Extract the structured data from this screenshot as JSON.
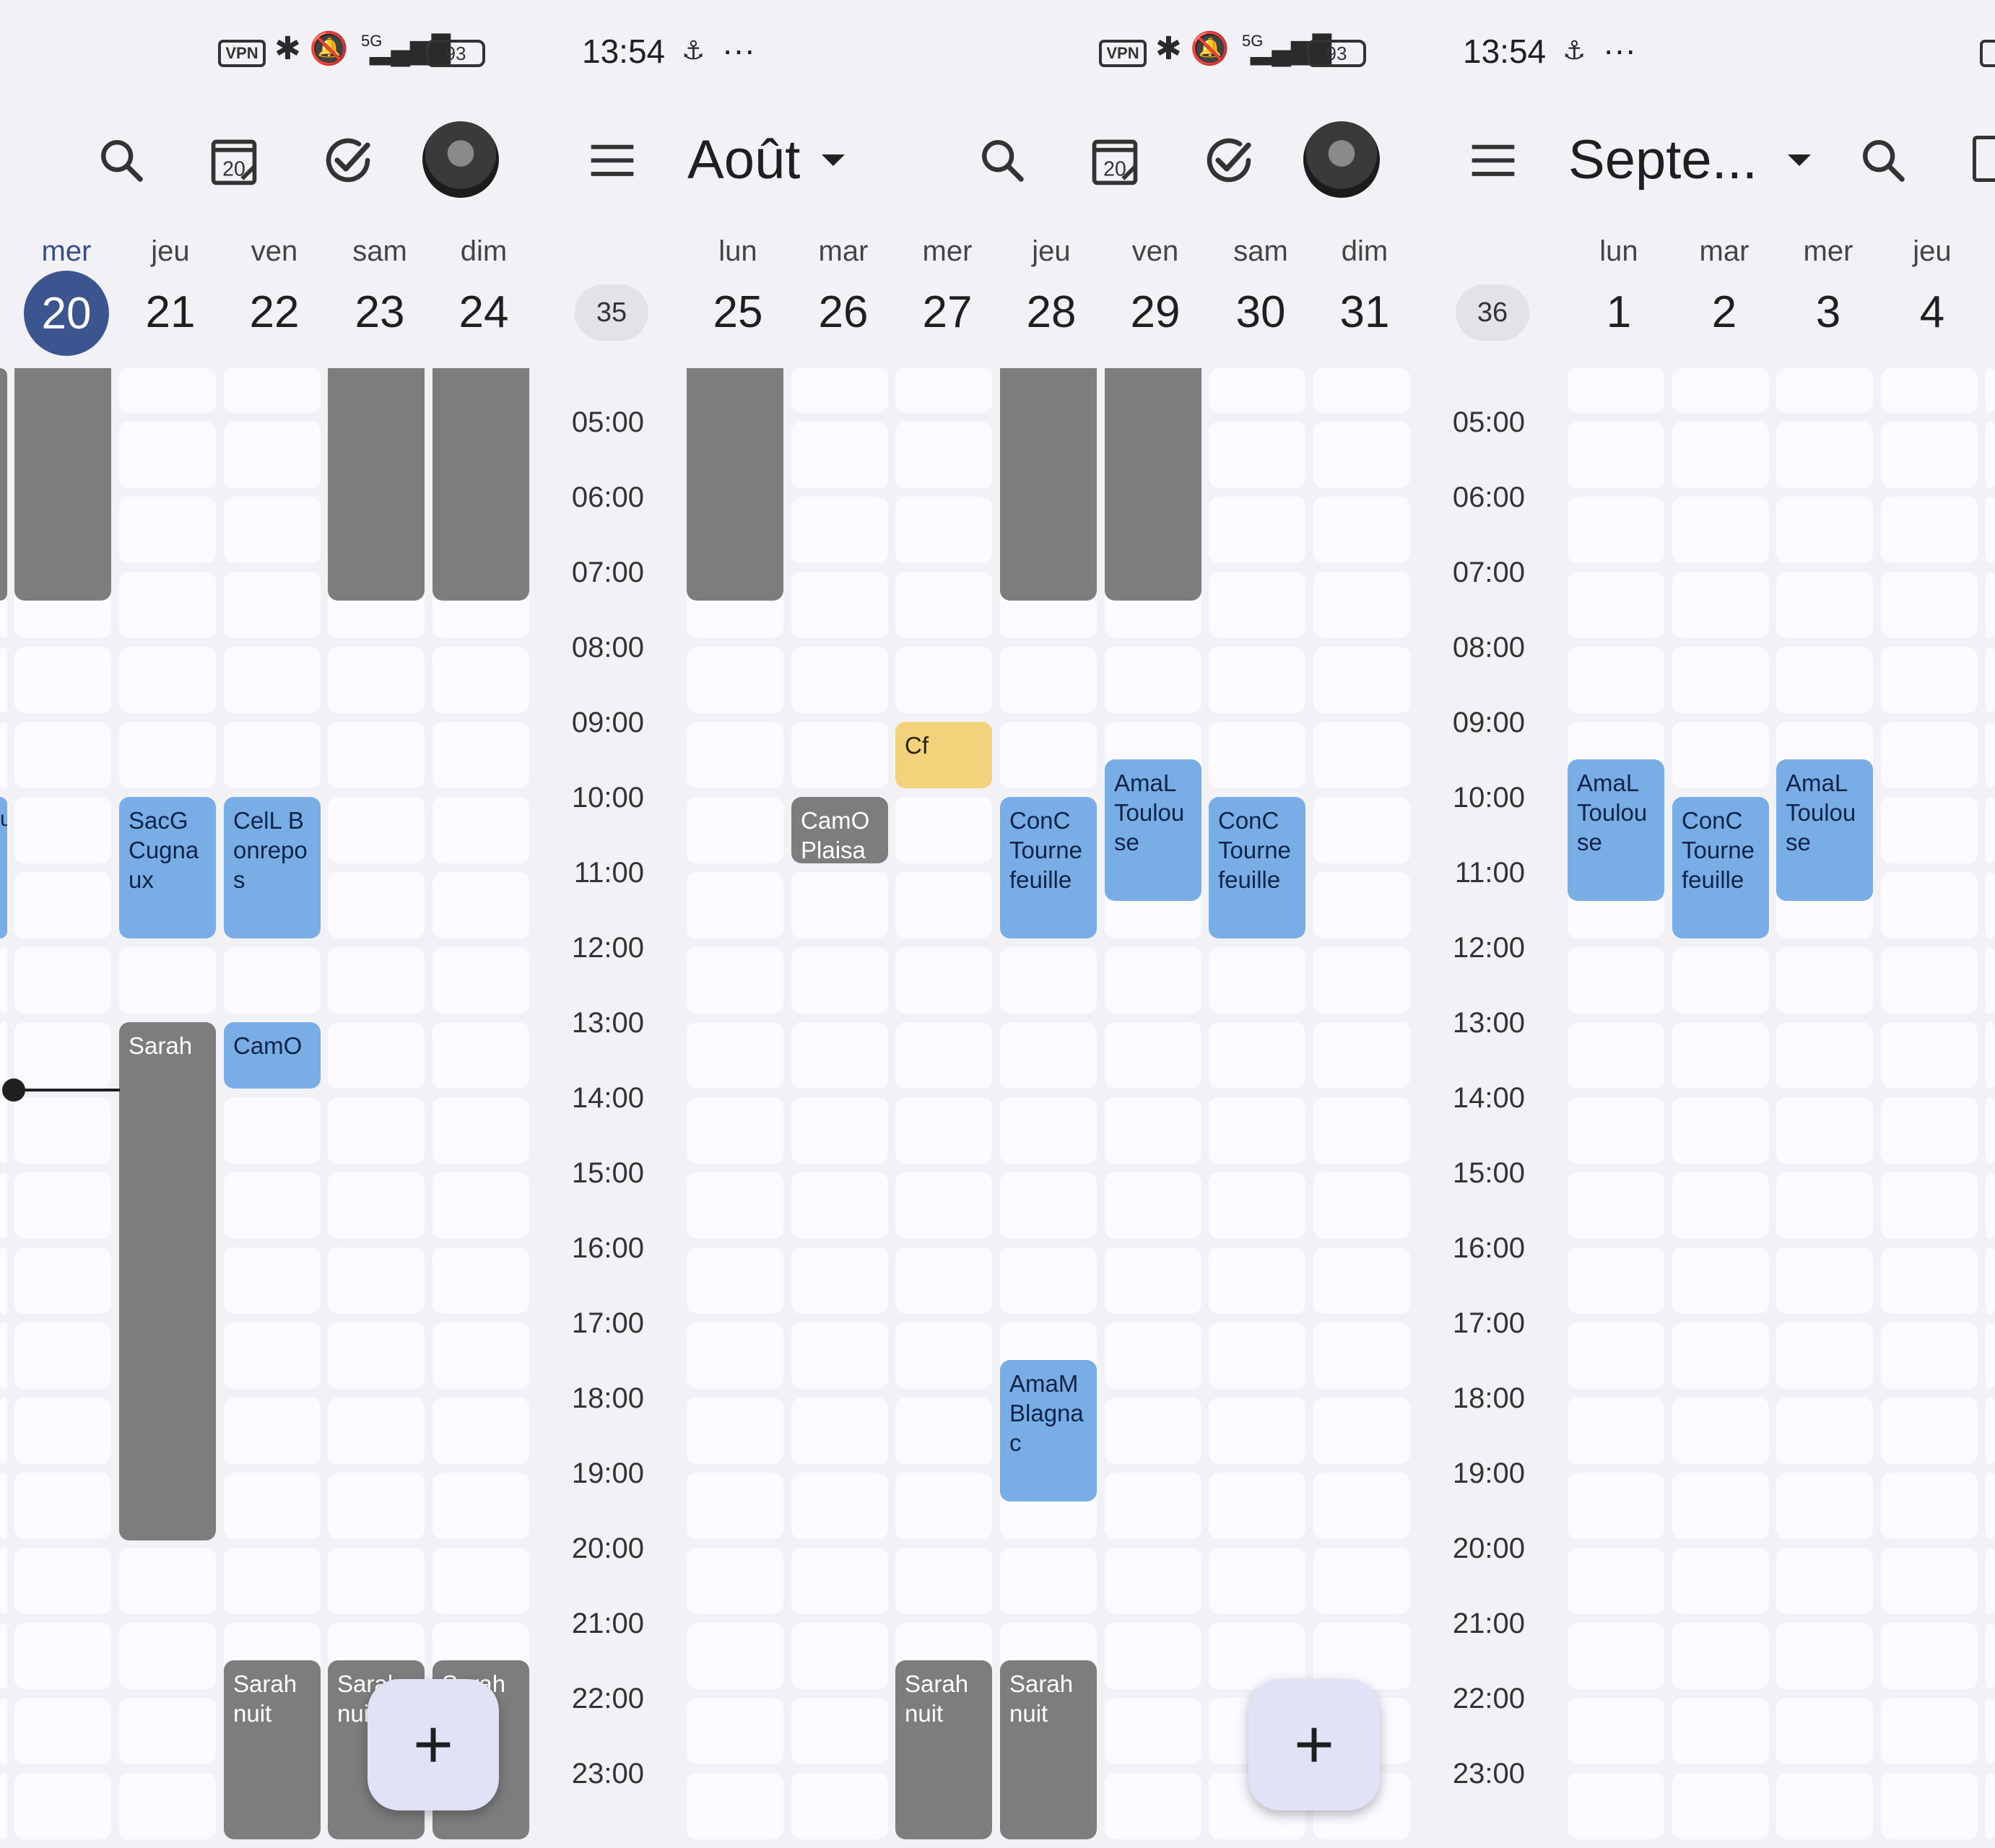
{
  "status_bar": {
    "time": "13:54",
    "vpn": "VPN",
    "network": "5G",
    "battery": "93",
    "more": "···",
    "icons": [
      "bluetooth-icon",
      "mute-icon",
      "signal-icon",
      "battery-icon",
      "sync-icon"
    ]
  },
  "toolbar": {
    "month_prev": "Août",
    "month_next": "Septe...",
    "today_num": "20",
    "icons": [
      "menu-icon",
      "search-icon",
      "today-icon",
      "tasks-icon",
      "avatar",
      "dropdown-icon"
    ]
  },
  "days": {
    "labels": [
      "mer",
      "jeu",
      "ven",
      "sam",
      "dim",
      "lun",
      "mar",
      "mer",
      "jeu",
      "ven",
      "sam",
      "dim",
      "lun",
      "mar",
      "mer",
      "jeu"
    ],
    "numbers": [
      "20",
      "21",
      "22",
      "23",
      "24",
      "25",
      "26",
      "27",
      "28",
      "29",
      "30",
      "31",
      "1",
      "2",
      "3",
      "4"
    ],
    "week_badges": [
      "35",
      "36"
    ]
  },
  "hours": [
    "05:00",
    "06:00",
    "07:00",
    "08:00",
    "09:00",
    "10:00",
    "11:00",
    "12:00",
    "13:00",
    "14:00",
    "15:00",
    "16:00",
    "17:00",
    "18:00",
    "19:00",
    "20:00",
    "21:00",
    "22:00",
    "23:00"
  ],
  "events": {
    "sacg": "SacG Cugnaux",
    "cell": "CelL Bonrepos",
    "sarah": "Sarah",
    "camo_short": "CamO",
    "sarah_nuit": "Sarah nuit",
    "cf": "Cf",
    "camo_plaisan": "CamO Plaisan",
    "conc": "ConC Tournefeuille",
    "amal": "AmaL Toulouse",
    "amam": "AmaM Blagnac",
    "partial_u": "u"
  },
  "fab": {
    "label": "+"
  },
  "colors": {
    "today": "#3c548f",
    "event_blue": "#78ade6",
    "event_gray": "#7d7d7d",
    "event_yellow": "#f2d27a",
    "fab": "#dfe3f5"
  }
}
